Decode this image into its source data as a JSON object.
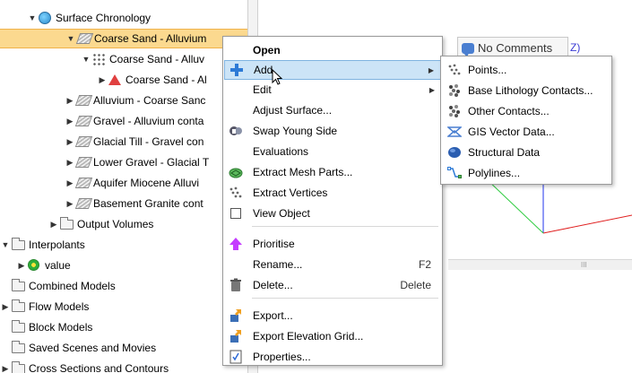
{
  "tree": {
    "items": [
      {
        "label": "Surface Chronology",
        "arrow": "▼",
        "icon": "chronology-icon"
      },
      {
        "label": "Coarse Sand - Alluvium",
        "arrow": "▼",
        "icon": "surface-icon"
      },
      {
        "label": "Coarse Sand - Alluv",
        "arrow": "▼",
        "icon": "points-icon"
      },
      {
        "label": "Coarse Sand - Al",
        "arrow": "▶",
        "icon": "wedge-icon"
      },
      {
        "label": "Alluvium - Coarse Sanc",
        "arrow": "▶",
        "icon": "surface-icon"
      },
      {
        "label": "Gravel - Alluvium conta",
        "arrow": "▶",
        "icon": "surface-icon"
      },
      {
        "label": "Glacial Till - Gravel con",
        "arrow": "▶",
        "icon": "surface-icon"
      },
      {
        "label": "Lower Gravel - Glacial T",
        "arrow": "▶",
        "icon": "surface-icon"
      },
      {
        "label": "Aquifer Miocene Alluvi",
        "arrow": "▶",
        "icon": "surface-icon"
      },
      {
        "label": "Basement Granite cont",
        "arrow": "▶",
        "icon": "surface-icon"
      },
      {
        "label": "Output Volumes",
        "arrow": "▶",
        "icon": "folder-icon"
      },
      {
        "label": "Interpolants",
        "arrow": "▼",
        "icon": "folder-icon"
      },
      {
        "label": "value",
        "arrow": "▶",
        "icon": "value-icon"
      },
      {
        "label": "Combined Models",
        "arrow": "",
        "icon": "folder-icon"
      },
      {
        "label": "Flow Models",
        "arrow": "▶",
        "icon": "folder-icon"
      },
      {
        "label": "Block Models",
        "arrow": "",
        "icon": "folder-icon"
      },
      {
        "label": "Saved Scenes and Movies",
        "arrow": "",
        "icon": "folder-icon"
      },
      {
        "label": "Cross Sections and Contours",
        "arrow": "▶",
        "icon": "folder-icon"
      }
    ]
  },
  "viewer": {
    "comments_label": "No Comments",
    "axis_label": "Z)",
    "scroll_mark": "III"
  },
  "context_menu": {
    "items": [
      {
        "label": "Open",
        "icon": "",
        "shortcut": "",
        "submenu": false
      },
      {
        "label": "Add",
        "icon": "add-icon",
        "shortcut": "",
        "submenu": true
      },
      {
        "label": "Edit",
        "icon": "",
        "shortcut": "",
        "submenu": true
      },
      {
        "label": "Adjust Surface...",
        "icon": "",
        "shortcut": "",
        "submenu": false
      },
      {
        "label": "Swap Young Side",
        "icon": "swap-icon",
        "shortcut": "",
        "submenu": false
      },
      {
        "label": "Evaluations",
        "icon": "",
        "shortcut": "",
        "submenu": false
      },
      {
        "label": "Extract Mesh Parts...",
        "icon": "mesh-icon",
        "shortcut": "",
        "submenu": false
      },
      {
        "label": "Extract Vertices",
        "icon": "vertices-icon",
        "shortcut": "",
        "submenu": false
      },
      {
        "label": "View Object",
        "icon": "checkbox-icon",
        "shortcut": "",
        "submenu": false
      },
      {
        "label": "Prioritise",
        "icon": "arrow-up-icon",
        "shortcut": "",
        "submenu": false
      },
      {
        "label": "Rename...",
        "icon": "",
        "shortcut": "F2",
        "submenu": false
      },
      {
        "label": "Delete...",
        "icon": "trash-icon",
        "shortcut": "Delete",
        "submenu": false
      },
      {
        "label": "Export...",
        "icon": "export-icon",
        "shortcut": "",
        "submenu": false
      },
      {
        "label": "Export Elevation Grid...",
        "icon": "export-icon",
        "shortcut": "",
        "submenu": false
      },
      {
        "label": "Properties...",
        "icon": "properties-icon",
        "shortcut": "",
        "submenu": false
      }
    ],
    "highlighted": "Add"
  },
  "submenu": {
    "items": [
      {
        "label": "Points...",
        "icon": "points-icon"
      },
      {
        "label": "Base Lithology Contacts...",
        "icon": "lithology-icon"
      },
      {
        "label": "Other Contacts...",
        "icon": "lithology-icon"
      },
      {
        "label": "GIS Vector Data...",
        "icon": "gis-icon"
      },
      {
        "label": "Structural Data",
        "icon": "structural-icon"
      },
      {
        "label": "Polylines...",
        "icon": "polyline-icon"
      }
    ]
  },
  "colors": {
    "selection": "#fbd98f",
    "menu_highlight": "#cce4f7",
    "axis_green": "#2ecc40",
    "axis_blue": "#2233ee",
    "axis_red": "#e02020"
  }
}
